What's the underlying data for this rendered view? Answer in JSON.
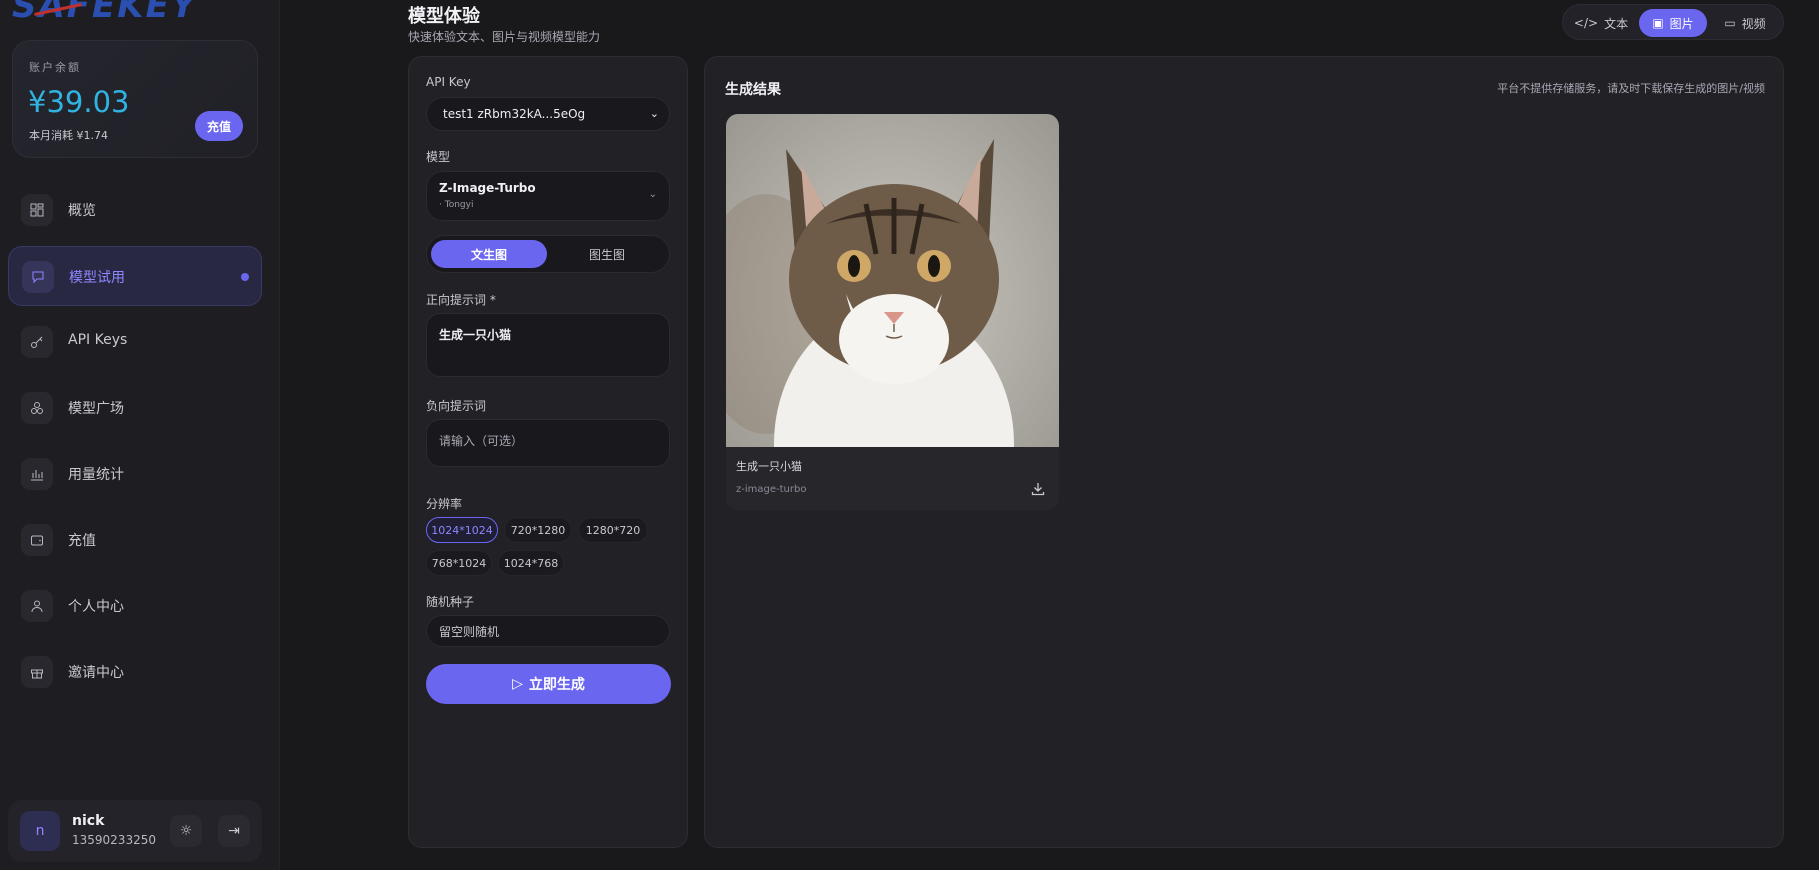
{
  "brand": {
    "logo_text": "SAFEKEY"
  },
  "balance": {
    "label": "账户余额",
    "amount": "¥39.03",
    "month_usage": "本月消耗 ¥1.74",
    "recharge_label": "充值"
  },
  "sidebar": {
    "items": [
      {
        "label": "概览",
        "icon": "grid-icon"
      },
      {
        "label": "模型试用",
        "icon": "chat-icon",
        "active": true
      },
      {
        "label": "API Keys",
        "icon": "key-icon"
      },
      {
        "label": "模型广场",
        "icon": "models-icon"
      },
      {
        "label": "用量统计",
        "icon": "bar-chart-icon"
      },
      {
        "label": "充值",
        "icon": "wallet-icon"
      },
      {
        "label": "个人中心",
        "icon": "user-icon"
      },
      {
        "label": "邀请中心",
        "icon": "gift-icon"
      }
    ]
  },
  "user": {
    "avatar_letter": "n",
    "name": "nick",
    "phone": "13590233250"
  },
  "header": {
    "title": "模型体验",
    "subtitle": "快速体验文本、图片与视频模型能力"
  },
  "mode_tabs": [
    {
      "label": "文本",
      "icon": "code-icon"
    },
    {
      "label": "图片",
      "icon": "image-icon",
      "active": true
    },
    {
      "label": "视频",
      "icon": "video-icon"
    }
  ],
  "form": {
    "api_key_label": "API Key",
    "api_key_value": "test1 zRbm32kA...5eOg",
    "model_label": "模型",
    "model_name": "Z-Image-Turbo",
    "model_vendor": "· Tongyi",
    "segments": [
      {
        "label": "文生图",
        "active": true
      },
      {
        "label": "图生图"
      }
    ],
    "positive_label": "正向提示词 *",
    "positive_value": "生成一只小猫",
    "negative_label": "负向提示词",
    "negative_placeholder": "请输入（可选）",
    "resolution_label": "分辨率",
    "resolutions": [
      "1024*1024",
      "720*1280",
      "1280*720",
      "768*1024",
      "1024*768"
    ],
    "resolution_selected": "1024*1024",
    "seed_label": "随机种子",
    "seed_placeholder": "留空则随机",
    "generate_label": "立即生成"
  },
  "result": {
    "title": "生成结果",
    "note": "平台不提供存储服务，请及时下载保存生成的图片/视频",
    "caption": "生成一只小猫",
    "model": "z-image-turbo"
  },
  "colors": {
    "accent": "#6b66f0",
    "balance": "#30b3e0",
    "background": "#19191c"
  }
}
